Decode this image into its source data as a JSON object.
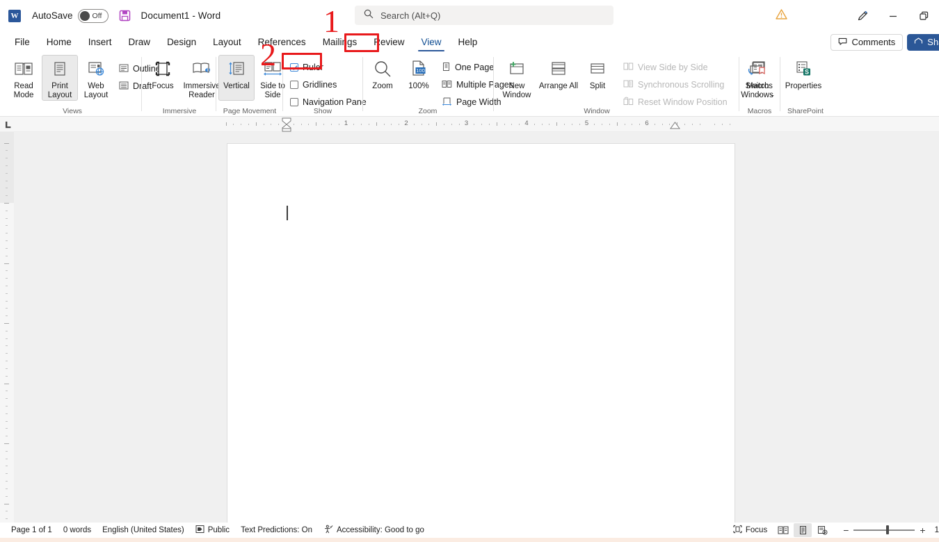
{
  "titlebar": {
    "app_icon": "word-logo-icon",
    "autosave_label": "AutoSave",
    "autosave_state": "Off",
    "save_icon": "save-disk-icon",
    "document_title": "Document1  -  Word",
    "warning_icon": "warning-triangle-icon",
    "pen_icon": "pen-ink-icon",
    "minimize_icon": "minimize-icon",
    "restore_icon": "restore-window-icon"
  },
  "search": {
    "icon": "search-icon",
    "placeholder": "Search (Alt+Q)"
  },
  "tabs": [
    {
      "label": "File",
      "active": false
    },
    {
      "label": "Home",
      "active": false
    },
    {
      "label": "Insert",
      "active": false
    },
    {
      "label": "Draw",
      "active": false
    },
    {
      "label": "Design",
      "active": false
    },
    {
      "label": "Layout",
      "active": false
    },
    {
      "label": "References",
      "active": false
    },
    {
      "label": "Mailings",
      "active": false
    },
    {
      "label": "Review",
      "active": false
    },
    {
      "label": "View",
      "active": true
    },
    {
      "label": "Help",
      "active": false
    }
  ],
  "tabrow_right": {
    "comments_label": "Comments",
    "comments_icon": "comment-bubble-icon",
    "share_label": "Share",
    "share_icon": "share-icon"
  },
  "ribbon": {
    "groups": [
      {
        "name": "Views",
        "label": "Views",
        "big_buttons": [
          {
            "label": "Read Mode",
            "icon": "read-mode-icon",
            "selected": false
          },
          {
            "label": "Print Layout",
            "icon": "print-layout-icon",
            "selected": true
          },
          {
            "label": "Web Layout",
            "icon": "web-layout-icon",
            "selected": false
          }
        ],
        "small_items": [
          {
            "label": "Outline",
            "icon": "outline-icon"
          },
          {
            "label": "Draft",
            "icon": "draft-icon"
          }
        ]
      },
      {
        "name": "Immersive",
        "label": "Immersive",
        "big_buttons": [
          {
            "label": "Focus",
            "icon": "focus-icon",
            "selected": false
          },
          {
            "label": "Immersive Reader",
            "icon": "immersive-reader-icon",
            "selected": false
          }
        ],
        "small_items": []
      },
      {
        "name": "Page Movement",
        "label": "Page Movement",
        "big_buttons": [
          {
            "label": "Vertical",
            "icon": "vertical-scroll-icon",
            "selected": true
          },
          {
            "label": "Side to Side",
            "icon": "side-to-side-icon",
            "selected": false
          }
        ],
        "small_items": []
      },
      {
        "name": "Show",
        "label": "Show",
        "big_buttons": [],
        "small_items": [
          {
            "label": "Ruler",
            "checked": true
          },
          {
            "label": "Gridlines",
            "checked": false
          },
          {
            "label": "Navigation Pane",
            "checked": false
          }
        ]
      },
      {
        "name": "Zoom",
        "label": "Zoom",
        "big_buttons": [
          {
            "label": "Zoom",
            "icon": "magnifier-icon",
            "selected": false
          },
          {
            "label": "100%",
            "icon": "zoom-100-icon",
            "selected": false
          }
        ],
        "small_items": [
          {
            "label": "One Page",
            "icon": "one-page-icon"
          },
          {
            "label": "Multiple Pages",
            "icon": "multiple-pages-icon"
          },
          {
            "label": "Page Width",
            "icon": "page-width-icon"
          }
        ]
      },
      {
        "name": "Window",
        "label": "Window",
        "big_buttons": [
          {
            "label": "New Window",
            "icon": "new-window-icon",
            "selected": false
          },
          {
            "label": "Arrange All",
            "icon": "arrange-all-icon",
            "selected": false
          },
          {
            "label": "Split",
            "icon": "split-icon",
            "selected": false
          }
        ],
        "small_items": [
          {
            "label": "View Side by Side",
            "icon": "view-side-by-side-icon",
            "disabled": true
          },
          {
            "label": "Synchronous Scrolling",
            "icon": "synchronous-scrolling-icon",
            "disabled": true
          },
          {
            "label": "Reset Window Position",
            "icon": "reset-window-position-icon",
            "disabled": true
          }
        ],
        "extra_big": [
          {
            "label": "Switch Windows",
            "icon": "switch-windows-icon",
            "dropdown": true
          }
        ]
      },
      {
        "name": "Macros",
        "label": "Macros",
        "big_buttons": [
          {
            "label": "Macros",
            "icon": "macros-icon",
            "dropdown": true
          }
        ],
        "small_items": []
      },
      {
        "name": "SharePoint",
        "label": "SharePoint",
        "big_buttons": [
          {
            "label": "Properties",
            "icon": "properties-icon",
            "selected": false
          }
        ],
        "small_items": []
      }
    ]
  },
  "ruler": {
    "tab_selector_icon": "tab-stop-left-icon",
    "numbers": [
      "1",
      "2",
      "3",
      "4",
      "5",
      "6"
    ],
    "left_indent_marker": "indent-marker-icon",
    "right_indent_marker": "right-indent-marker-icon"
  },
  "document": {
    "caret": "text-cursor"
  },
  "statusbar": {
    "page": "Page 1 of 1",
    "words": "0 words",
    "language": "English (United States)",
    "sensitivity_icon": "sensitivity-label-icon",
    "sensitivity": "Public",
    "text_predictions": "Text Predictions: On",
    "accessibility_icon": "accessibility-icon",
    "accessibility": "Accessibility: Good to go",
    "focus_icon": "focus-icon",
    "focus_label": "Focus",
    "view_read_icon": "read-mode-view-icon",
    "view_print_icon": "print-layout-view-icon",
    "view_web_icon": "web-layout-view-icon",
    "zoom_out": "−",
    "zoom_in": "+",
    "zoom_value": "1"
  },
  "annotations": [
    {
      "number": "1",
      "target": "View tab"
    },
    {
      "number": "2",
      "target": "Ruler checkbox"
    }
  ],
  "colors": {
    "accent": "#2b5797",
    "annotation": "#e8191b",
    "ribbon_bg": "#ffffff",
    "doc_bg": "#f0f0f0"
  }
}
